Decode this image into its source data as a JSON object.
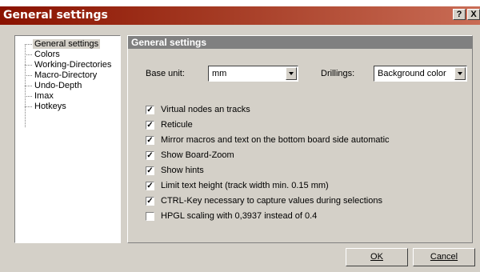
{
  "window": {
    "title": "General settings",
    "help_label": "?",
    "close_label": "X"
  },
  "tree": {
    "items": [
      {
        "label": "General settings",
        "selected": true
      },
      {
        "label": "Colors"
      },
      {
        "label": "Working-Directories"
      },
      {
        "label": "Macro-Directory"
      },
      {
        "label": "Undo-Depth"
      },
      {
        "label": "Imax"
      },
      {
        "label": "Hotkeys"
      }
    ]
  },
  "panel": {
    "header": "General settings",
    "base_unit": {
      "label": "Base unit:",
      "value": "mm"
    },
    "drillings": {
      "label": "Drillings:",
      "value": "Background color"
    },
    "options": [
      {
        "label": "Virtual nodes an tracks",
        "checked": true
      },
      {
        "label": "Reticule",
        "checked": true
      },
      {
        "label": "Mirror macros and text on the bottom board side automatic",
        "checked": true
      },
      {
        "label": "Show Board-Zoom",
        "checked": true
      },
      {
        "label": "Show hints",
        "checked": true
      },
      {
        "label": "Limit text height (track width min. 0.15 mm)",
        "checked": true
      },
      {
        "label": "CTRL-Key necessary to capture values during selections",
        "checked": true
      },
      {
        "label": "HPGL scaling with 0,3937 instead of 0.4",
        "checked": false
      }
    ]
  },
  "buttons": {
    "ok": "OK",
    "cancel": "Cancel"
  },
  "colors": {
    "titlebar_start": "#8a1200",
    "face": "#d4d0c8",
    "header": "#808080"
  }
}
